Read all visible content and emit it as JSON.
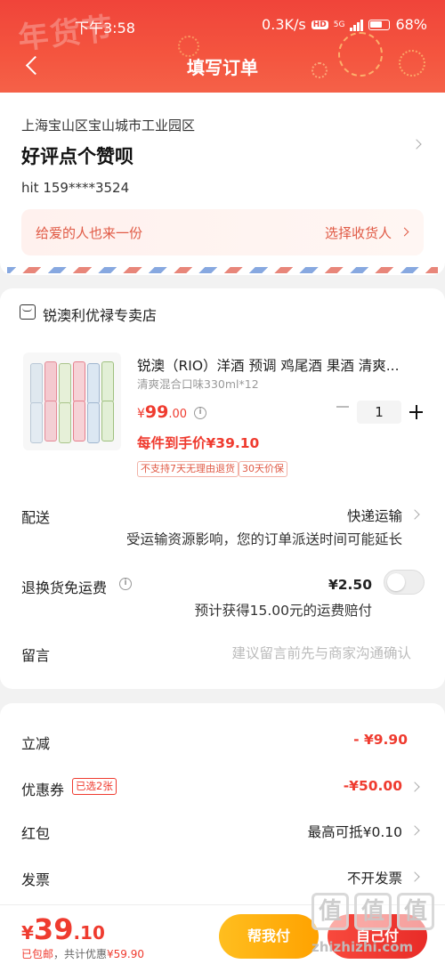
{
  "status_bar": {
    "time": "下午3:58",
    "network_speed": "0.3K/s",
    "hd_badge": "HD",
    "network_type": "5G",
    "battery": "68%"
  },
  "header": {
    "title": "填写订单",
    "decoration_text": "年货节"
  },
  "address": {
    "region": "上海宝山区宝山城市工业园区",
    "detail": "好评点个赞呗",
    "contact": "hit  159****3524",
    "gift_text": "给爱的人也来一份",
    "gift_action": "选择收货人"
  },
  "store": {
    "name": "锐澳利优禄专卖店"
  },
  "product": {
    "title": "锐澳（RIO）洋酒 预调 鸡尾酒 果酒 清爽...",
    "spec": "清爽混合口味330ml*12",
    "price_symbol": "¥",
    "price_int": "99",
    "price_dec": ".00",
    "final_price": "每件到手价¥39.10",
    "quantity": "1",
    "tags": [
      "不支持7天无理由退货",
      "30天价保"
    ]
  },
  "delivery": {
    "label": "配送",
    "value": "快递运输",
    "note": "受运输资源影响，您的订单派送时间可能延长"
  },
  "return_insurance": {
    "label": "退换货免运费",
    "price": "¥2.50",
    "note": "预计获得15.00元的运费赔付",
    "enabled": false
  },
  "message": {
    "label": "留言",
    "placeholder": "建议留言前先与商家沟通确认"
  },
  "discounts": {
    "instant": {
      "label": "立减",
      "value": "- ¥9.90"
    },
    "coupon": {
      "label": "优惠券",
      "tag": "已选2张",
      "value": "-¥50.00"
    },
    "red_packet": {
      "label": "红包",
      "value": "最高可抵¥0.10"
    },
    "invoice": {
      "label": "发票",
      "value": "不开发票"
    }
  },
  "bottom": {
    "total_symbol": "¥",
    "total_int": "39",
    "total_dec": ".10",
    "shipping": "已包邮",
    "saving_prefix": "，共计优惠",
    "saving_value": "¥59.90",
    "pay_friend_label": "帮我付",
    "pay_self_label": "自己付"
  },
  "watermark": {
    "glyph": "值",
    "text": "zhizhizhi.com"
  },
  "colors": {
    "brand_red": "#ef3b2f",
    "header_red": "#f0443a",
    "pay_friend_yellow": "#ffb300",
    "tag_red": "#e05a45"
  },
  "icons": [
    "back-arrow-icon",
    "shop-icon",
    "info-icon",
    "chevron-right-icon",
    "minus-icon",
    "plus-icon"
  ]
}
